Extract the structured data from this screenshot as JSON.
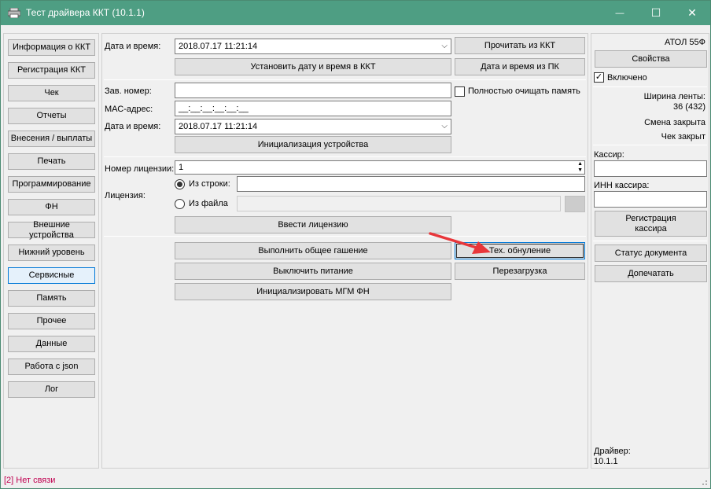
{
  "window": {
    "title": "Тест драйвера ККТ (10.1.1)",
    "controls": {
      "minimize": "—",
      "maximize": "☐",
      "close": "✕"
    }
  },
  "sidebar": {
    "items": [
      {
        "label": "Информация о ККТ"
      },
      {
        "label": "Регистрация ККТ"
      },
      {
        "label": "Чек"
      },
      {
        "label": "Отчеты"
      },
      {
        "label": "Внесения / выплаты"
      },
      {
        "label": "Печать"
      },
      {
        "label": "Программирование"
      },
      {
        "label": "ФН"
      },
      {
        "label": "Внешние устройства"
      },
      {
        "label": "Нижний уровень"
      },
      {
        "label": "Сервисные"
      },
      {
        "label": "Память"
      },
      {
        "label": "Прочее"
      },
      {
        "label": "Данные"
      },
      {
        "label": "Работа с json"
      },
      {
        "label": "Лог"
      }
    ],
    "active_index": 10
  },
  "main": {
    "datetime_label": "Дата и время:",
    "datetime_value": "2018.07.17 11:21:14",
    "read_from_kkt": "Прочитать из ККТ",
    "set_datetime": "Установить дату и время в ККТ",
    "datetime_from_pc": "Дата и время из ПК",
    "serial_label": "Зав. номер:",
    "serial_value": "",
    "clear_memory_label": "Полностью очищать память",
    "mac_label": "МАС-адрес:",
    "mac_value": "__:__:__:__:__:__",
    "init_datetime_label": "Дата и время:",
    "init_datetime_value": "2018.07.17 11:21:14",
    "init_device": "Инициализация устройства",
    "license_number_label": "Номер лицензии:",
    "license_number_value": "1",
    "license_label": "Лицензия:",
    "from_string_label": "Из строки:",
    "from_string_value": "",
    "from_file_label": "Из файла",
    "from_file_value": "",
    "enter_license": "Ввести лицензию",
    "general_cancel": "Выполнить общее гашение",
    "tech_reset": "Тех. обнуление",
    "power_off": "Выключить питание",
    "reboot": "Перезагрузка",
    "init_mgm_fn": "Инициализировать МГМ ФН"
  },
  "right": {
    "model": "АТОЛ 55Ф",
    "properties": "Свойства",
    "enabled_label": "Включено",
    "tape_width_label": "Ширина ленты:",
    "tape_width_value": "36 (432)",
    "shift_status": "Смена закрыта",
    "receipt_status": "Чек закрыт",
    "cashier_label": "Кассир:",
    "cashier_value": "",
    "cashier_inn_label": "ИНН кассира:",
    "cashier_inn_value": "",
    "register_cashier_line1": "Регистрация",
    "register_cashier_line2": "кассира",
    "document_status": "Статус документа",
    "reprint": "Допечатать",
    "driver_label": "Драйвер:",
    "driver_version": "10.1.1"
  },
  "status": {
    "text": "[2] Нет связи"
  },
  "colors": {
    "titlebar": "#4e9e83",
    "status_error": "#c00050",
    "arrow": "#e8363a",
    "focus": "#0078d7"
  }
}
